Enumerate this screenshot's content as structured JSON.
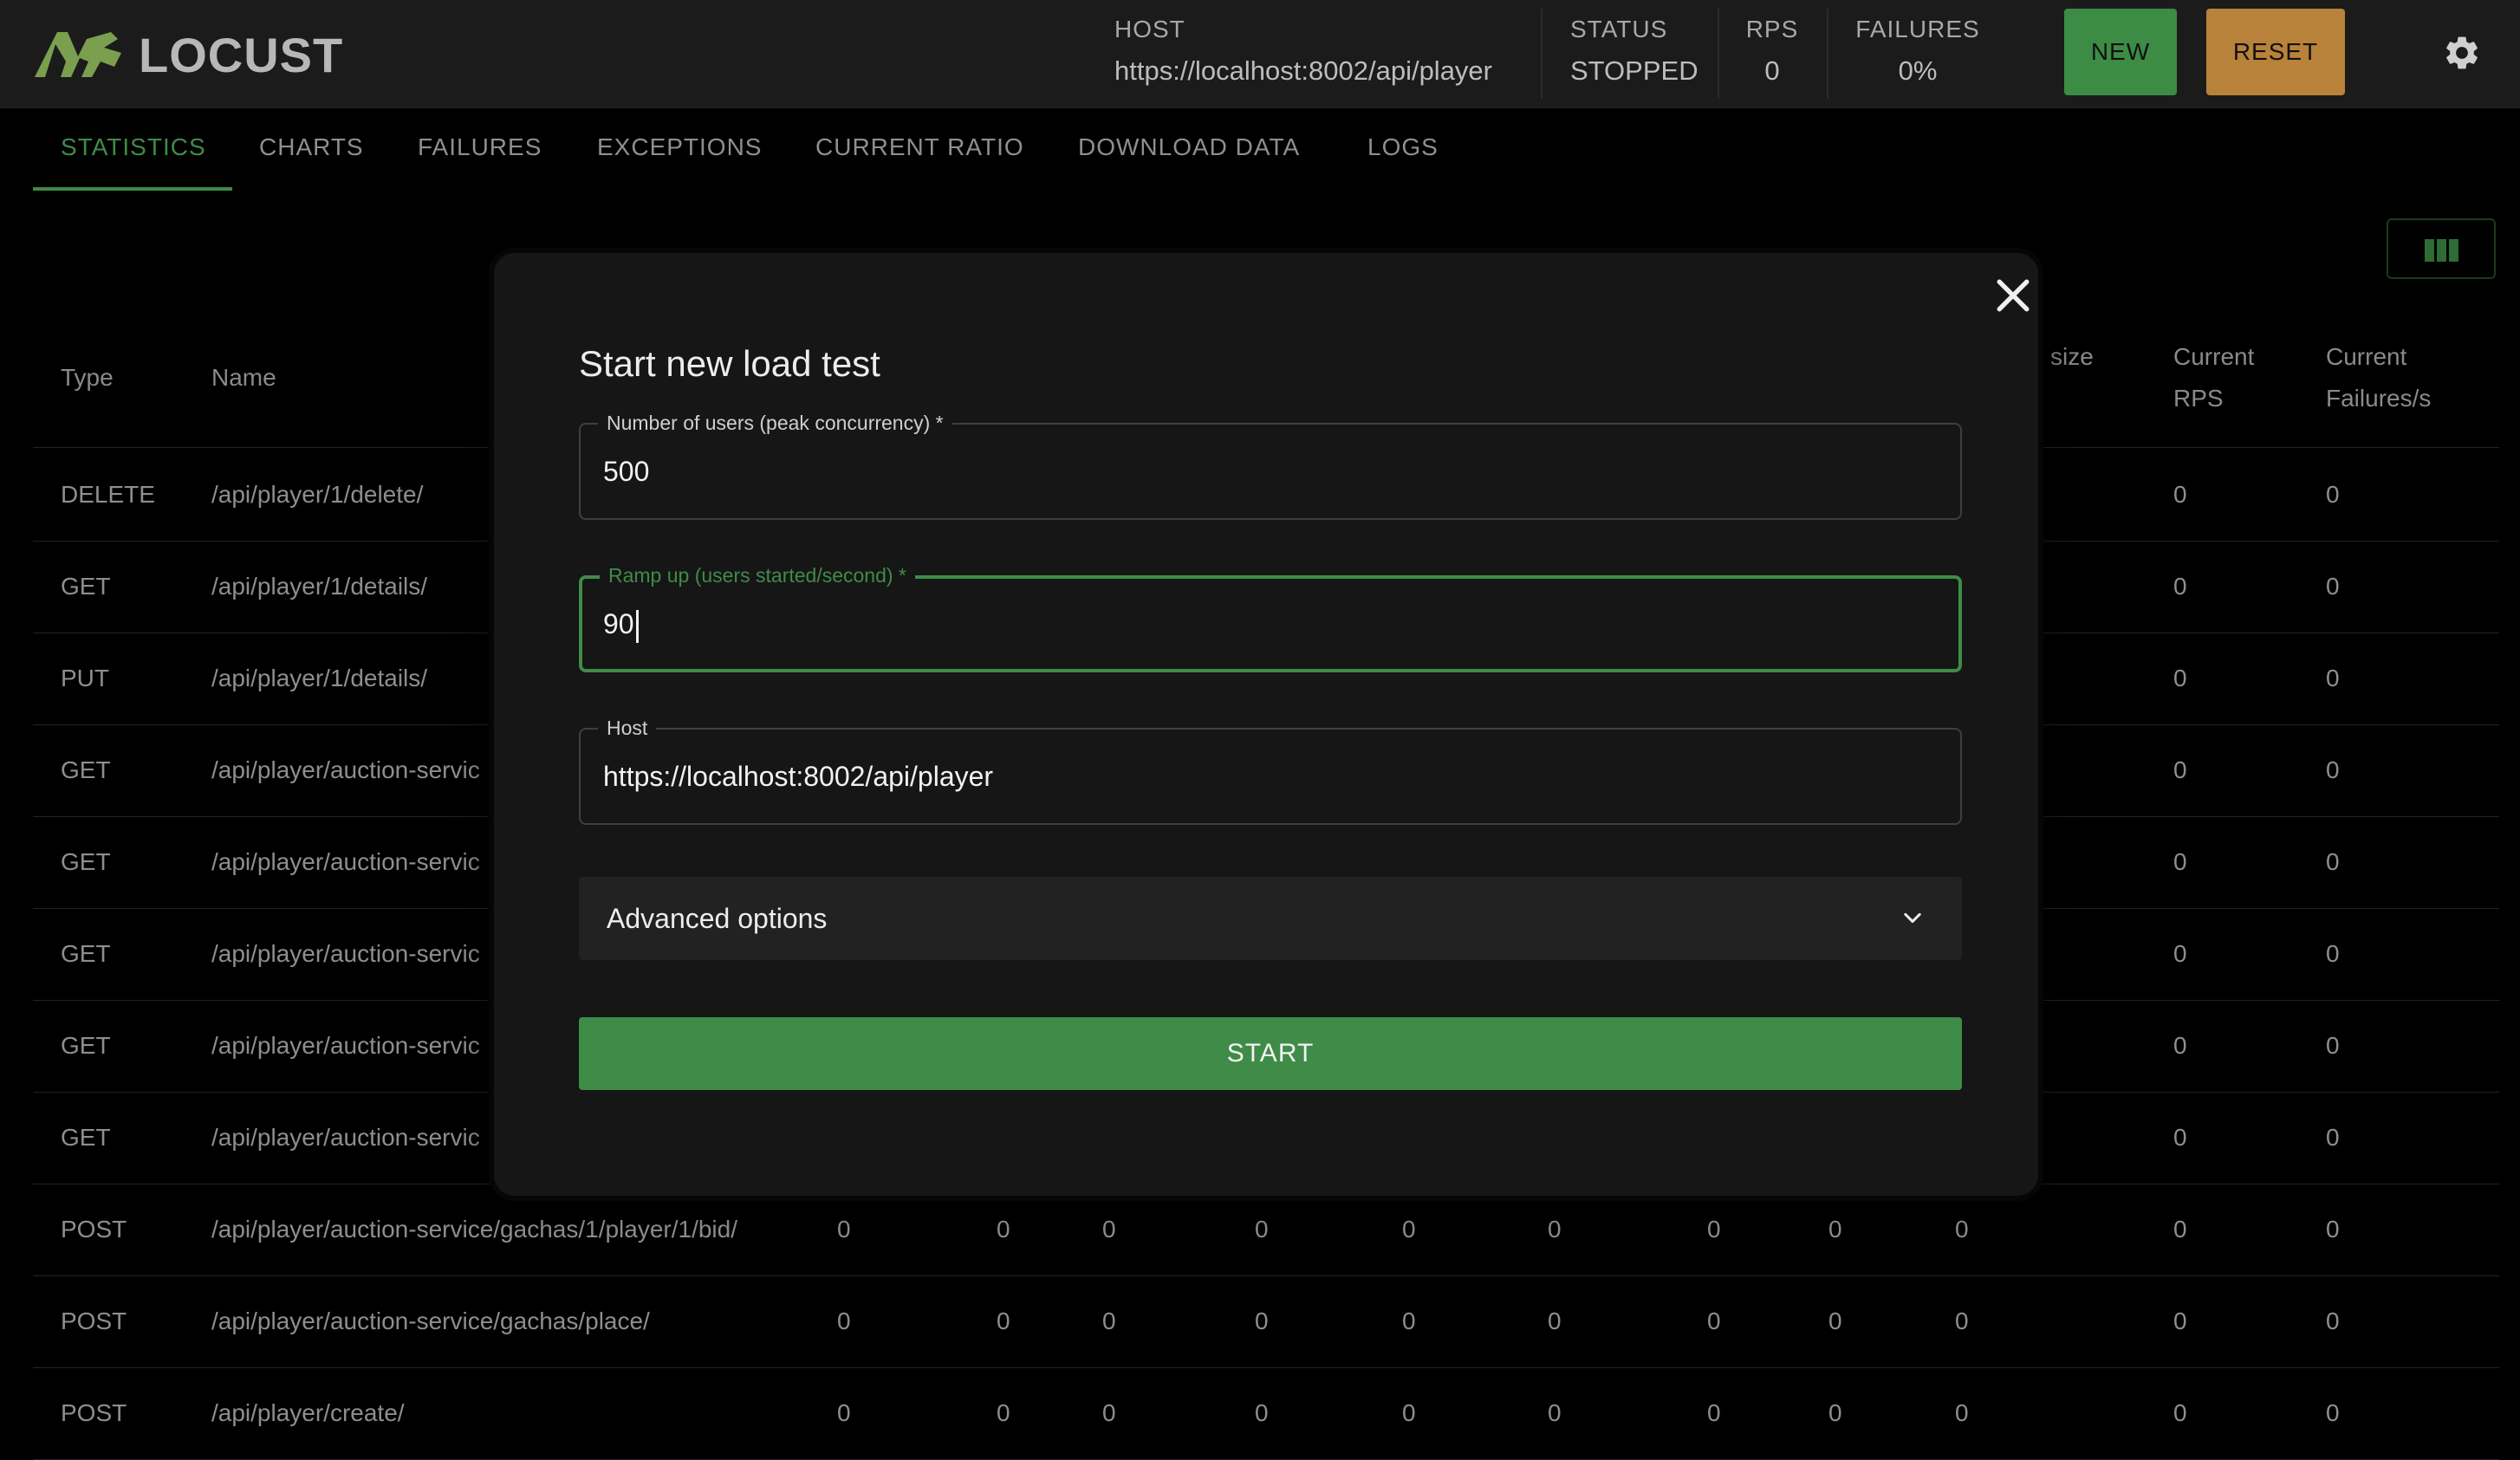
{
  "app": {
    "name": "LOCUST"
  },
  "header": {
    "host_label": "HOST",
    "host_value": "https://localhost:8002/api/player",
    "status_label": "STATUS",
    "status_value": "STOPPED",
    "rps_label": "RPS",
    "rps_value": "0",
    "failures_label": "FAILURES",
    "failures_value": "0%",
    "new_label": "NEW",
    "reset_label": "RESET"
  },
  "tabs": [
    "STATISTICS",
    "CHARTS",
    "FAILURES",
    "EXCEPTIONS",
    "CURRENT RATIO",
    "DOWNLOAD DATA",
    "LOGS"
  ],
  "active_tab": "STATISTICS",
  "table": {
    "headers": {
      "type": "Type",
      "name": "Name",
      "size": "size",
      "current_rps_1": "Current",
      "current_rps_2": "RPS",
      "current_failures_1": "Current",
      "current_failures_2": "Failures/s"
    },
    "rows": [
      {
        "type": "DELETE",
        "name": "/api/player/1/delete/",
        "values": [],
        "rps": "0",
        "fails": "0"
      },
      {
        "type": "GET",
        "name": "/api/player/1/details/",
        "values": [],
        "rps": "0",
        "fails": "0"
      },
      {
        "type": "PUT",
        "name": "/api/player/1/details/",
        "values": [],
        "rps": "0",
        "fails": "0"
      },
      {
        "type": "GET",
        "name": "/api/player/auction-servic",
        "values": [],
        "rps": "0",
        "fails": "0"
      },
      {
        "type": "GET",
        "name": "/api/player/auction-servic",
        "values": [],
        "rps": "0",
        "fails": "0"
      },
      {
        "type": "GET",
        "name": "/api/player/auction-servic",
        "values": [],
        "rps": "0",
        "fails": "0"
      },
      {
        "type": "GET",
        "name": "/api/player/auction-servic",
        "values": [],
        "rps": "0",
        "fails": "0"
      },
      {
        "type": "GET",
        "name": "/api/player/auction-servic",
        "values": [],
        "rps": "0",
        "fails": "0"
      },
      {
        "type": "POST",
        "name": "/api/player/auction-service/gachas/1/player/1/bid/",
        "values": [
          "0",
          "0",
          "0",
          "0",
          "0",
          "0",
          "0",
          "0",
          "0"
        ],
        "rps": "0",
        "fails": "0"
      },
      {
        "type": "POST",
        "name": "/api/player/auction-service/gachas/place/",
        "values": [
          "0",
          "0",
          "0",
          "0",
          "0",
          "0",
          "0",
          "0",
          "0"
        ],
        "rps": "0",
        "fails": "0"
      },
      {
        "type": "POST",
        "name": "/api/player/create/",
        "values": [
          "0",
          "0",
          "0",
          "0",
          "0",
          "0",
          "0",
          "0",
          "0"
        ],
        "rps": "0",
        "fails": "0"
      }
    ]
  },
  "modal": {
    "title": "Start new load test",
    "users_label": "Number of users (peak concurrency) *",
    "users_value": "500",
    "ramp_label": "Ramp up (users started/second) *",
    "ramp_value": "90",
    "host_label": "Host",
    "host_value": "https://localhost:8002/api/player",
    "advanced_label": "Advanced options",
    "start_label": "START"
  },
  "colors": {
    "accent_green": "#3e8c47",
    "reset_orange": "#b8823a",
    "background": "#000000",
    "topbar": "#1b1b1b"
  },
  "icons": [
    "locust-logo-icon",
    "settings-gear-icon",
    "columns-icon",
    "close-icon",
    "chevron-down-icon"
  ]
}
